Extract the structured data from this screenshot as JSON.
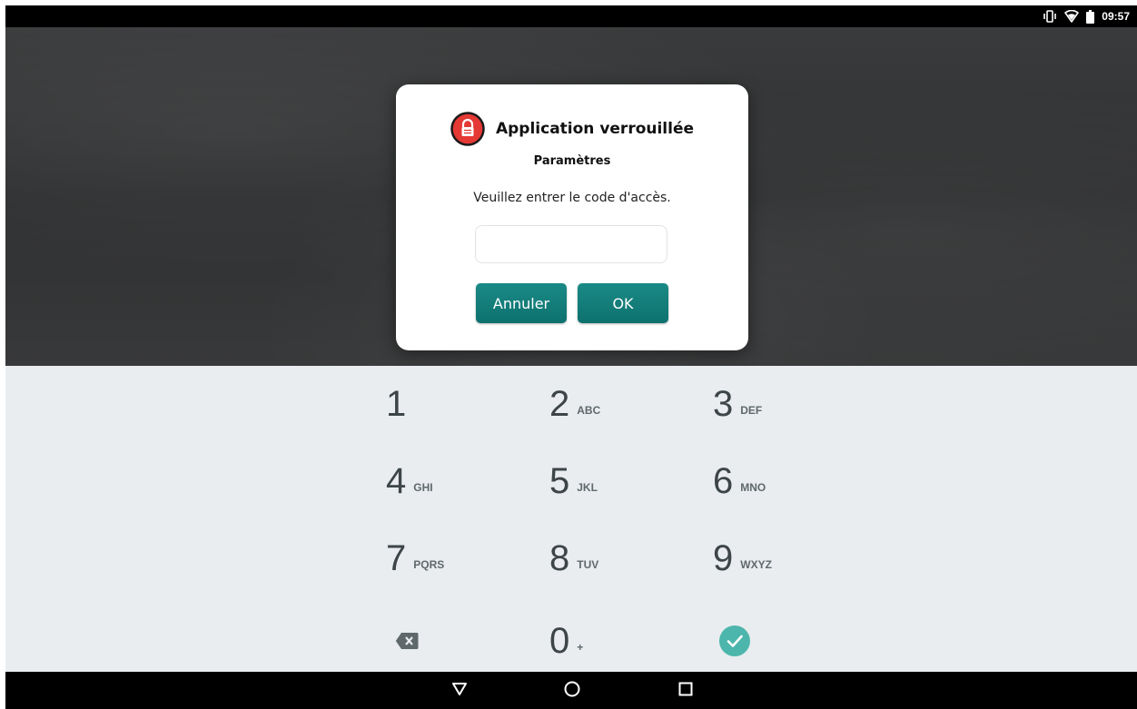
{
  "status_bar": {
    "time": "09:57",
    "icons": [
      "vibrate-icon",
      "wifi-icon",
      "battery-icon"
    ]
  },
  "dialog": {
    "title": "Application verrouillée",
    "subtitle": "Paramètres",
    "message": "Veuillez entrer le code d'accès.",
    "code_value": "",
    "cancel_label": "Annuler",
    "ok_label": "OK",
    "accent_color": "#0e716e",
    "lock_icon_color": "#e53935"
  },
  "keypad": {
    "keys": [
      {
        "digit": "1",
        "letters": ""
      },
      {
        "digit": "2",
        "letters": "ABC"
      },
      {
        "digit": "3",
        "letters": "DEF"
      },
      {
        "digit": "4",
        "letters": "GHI"
      },
      {
        "digit": "5",
        "letters": "JKL"
      },
      {
        "digit": "6",
        "letters": "MNO"
      },
      {
        "digit": "7",
        "letters": "PQRS"
      },
      {
        "digit": "8",
        "letters": "TUV"
      },
      {
        "digit": "9",
        "letters": "WXYZ"
      },
      {
        "digit": "0",
        "letters": "+"
      }
    ],
    "backspace_icon": "backspace-icon",
    "confirm_icon": "checkmark-icon",
    "confirm_color": "#4db6ac"
  },
  "nav_bar": {
    "icons": [
      "back-icon",
      "home-icon",
      "recents-icon"
    ]
  }
}
